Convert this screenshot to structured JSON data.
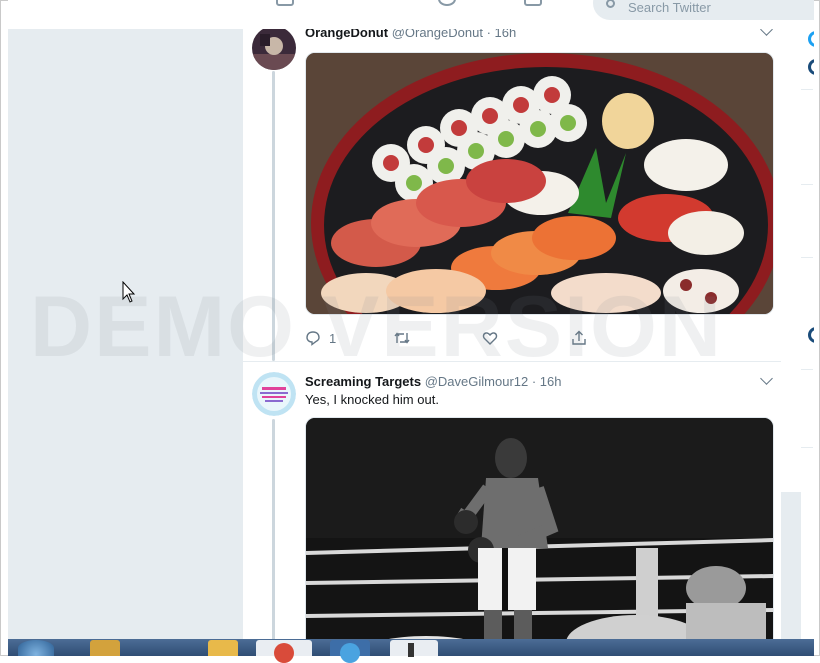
{
  "browser": {
    "search_placeholder": "Search Twitter"
  },
  "tweets": [
    {
      "name": "OrangeDonut",
      "handle": "@OrangeDonut",
      "time": "· 16h",
      "media_icon": "sushi-platter-photo",
      "reply_count": "1"
    },
    {
      "name": "Screaming Targets",
      "handle": "@DaveGilmour12",
      "time": "· 16h",
      "text": "Yes, I knocked him out.",
      "media_icon": "boxing-ring-photo"
    }
  ],
  "watermark": "DEMO VERSION",
  "colors": {
    "left_background": "#e6ecf0",
    "secondary_text": "#657786",
    "thread_line": "#ccd6dd",
    "accent_blue": "#1da1f2"
  }
}
